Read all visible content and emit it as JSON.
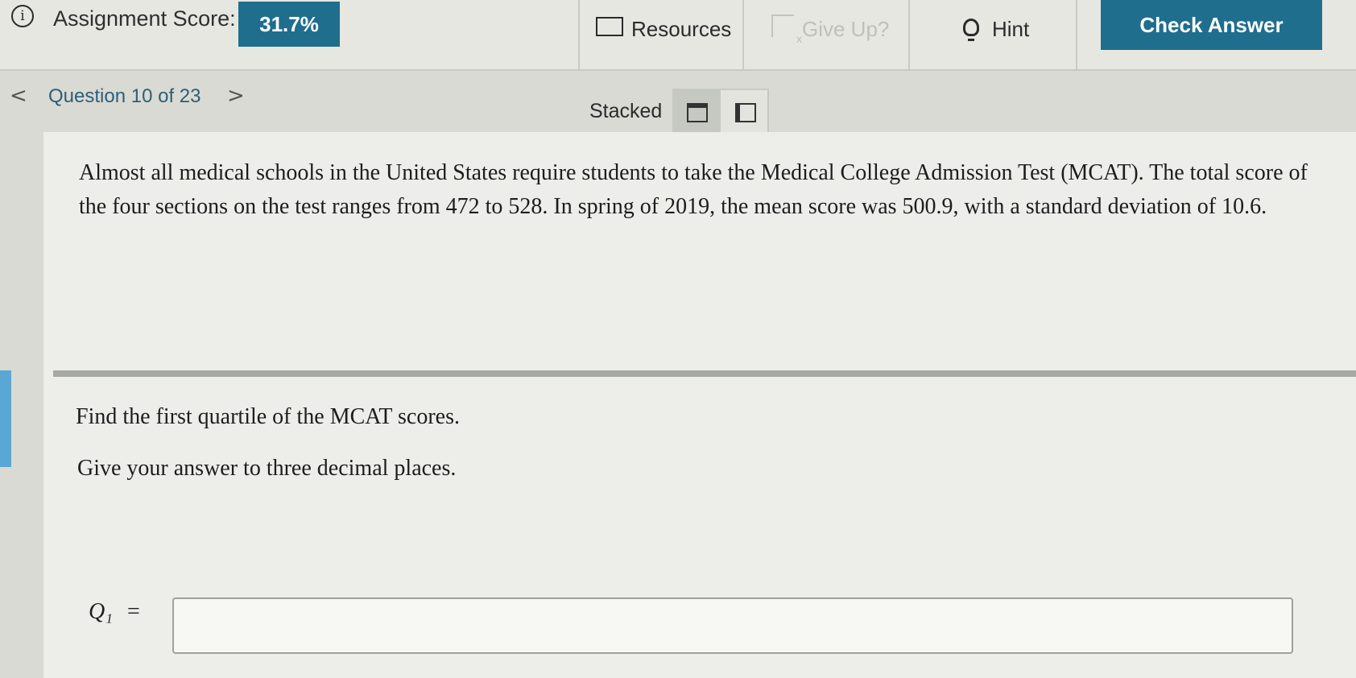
{
  "header": {
    "info_glyph": "i",
    "assignment_score_label": "Assignment Score:",
    "assignment_score_value": "31.7%",
    "resources_label": "Resources",
    "give_up_label": "Give Up?",
    "hint_label": "Hint",
    "check_answer_label": "Check Answer"
  },
  "nav": {
    "prev_glyph": "<",
    "question_label": "Question 10 of 23",
    "next_glyph": ">"
  },
  "layout": {
    "label": "Stacked",
    "selected": "stacked"
  },
  "problem": {
    "text": "Almost all medical schools in the United States require students to take the Medical College Admission Test (MCAT). The total score of the four sections on the test ranges from 472 to 528. In spring of 2019, the mean score was 500.9, with a standard deviation of 10.6."
  },
  "question": {
    "prompt": "Find the first quartile of the MCAT scores.",
    "instruction": "Give your answer to three decimal places.",
    "answer_label": "Q₁",
    "equals": "=",
    "answer_value": ""
  },
  "colors": {
    "accent": "#1f6e8e",
    "left_accent": "#5aa6d4"
  },
  "icons": [
    "info-icon",
    "folder-icon",
    "give-up-icon",
    "lightbulb-icon",
    "chevron-left-icon",
    "chevron-right-icon",
    "stacked-layout-icon",
    "side-by-side-layout-icon"
  ]
}
